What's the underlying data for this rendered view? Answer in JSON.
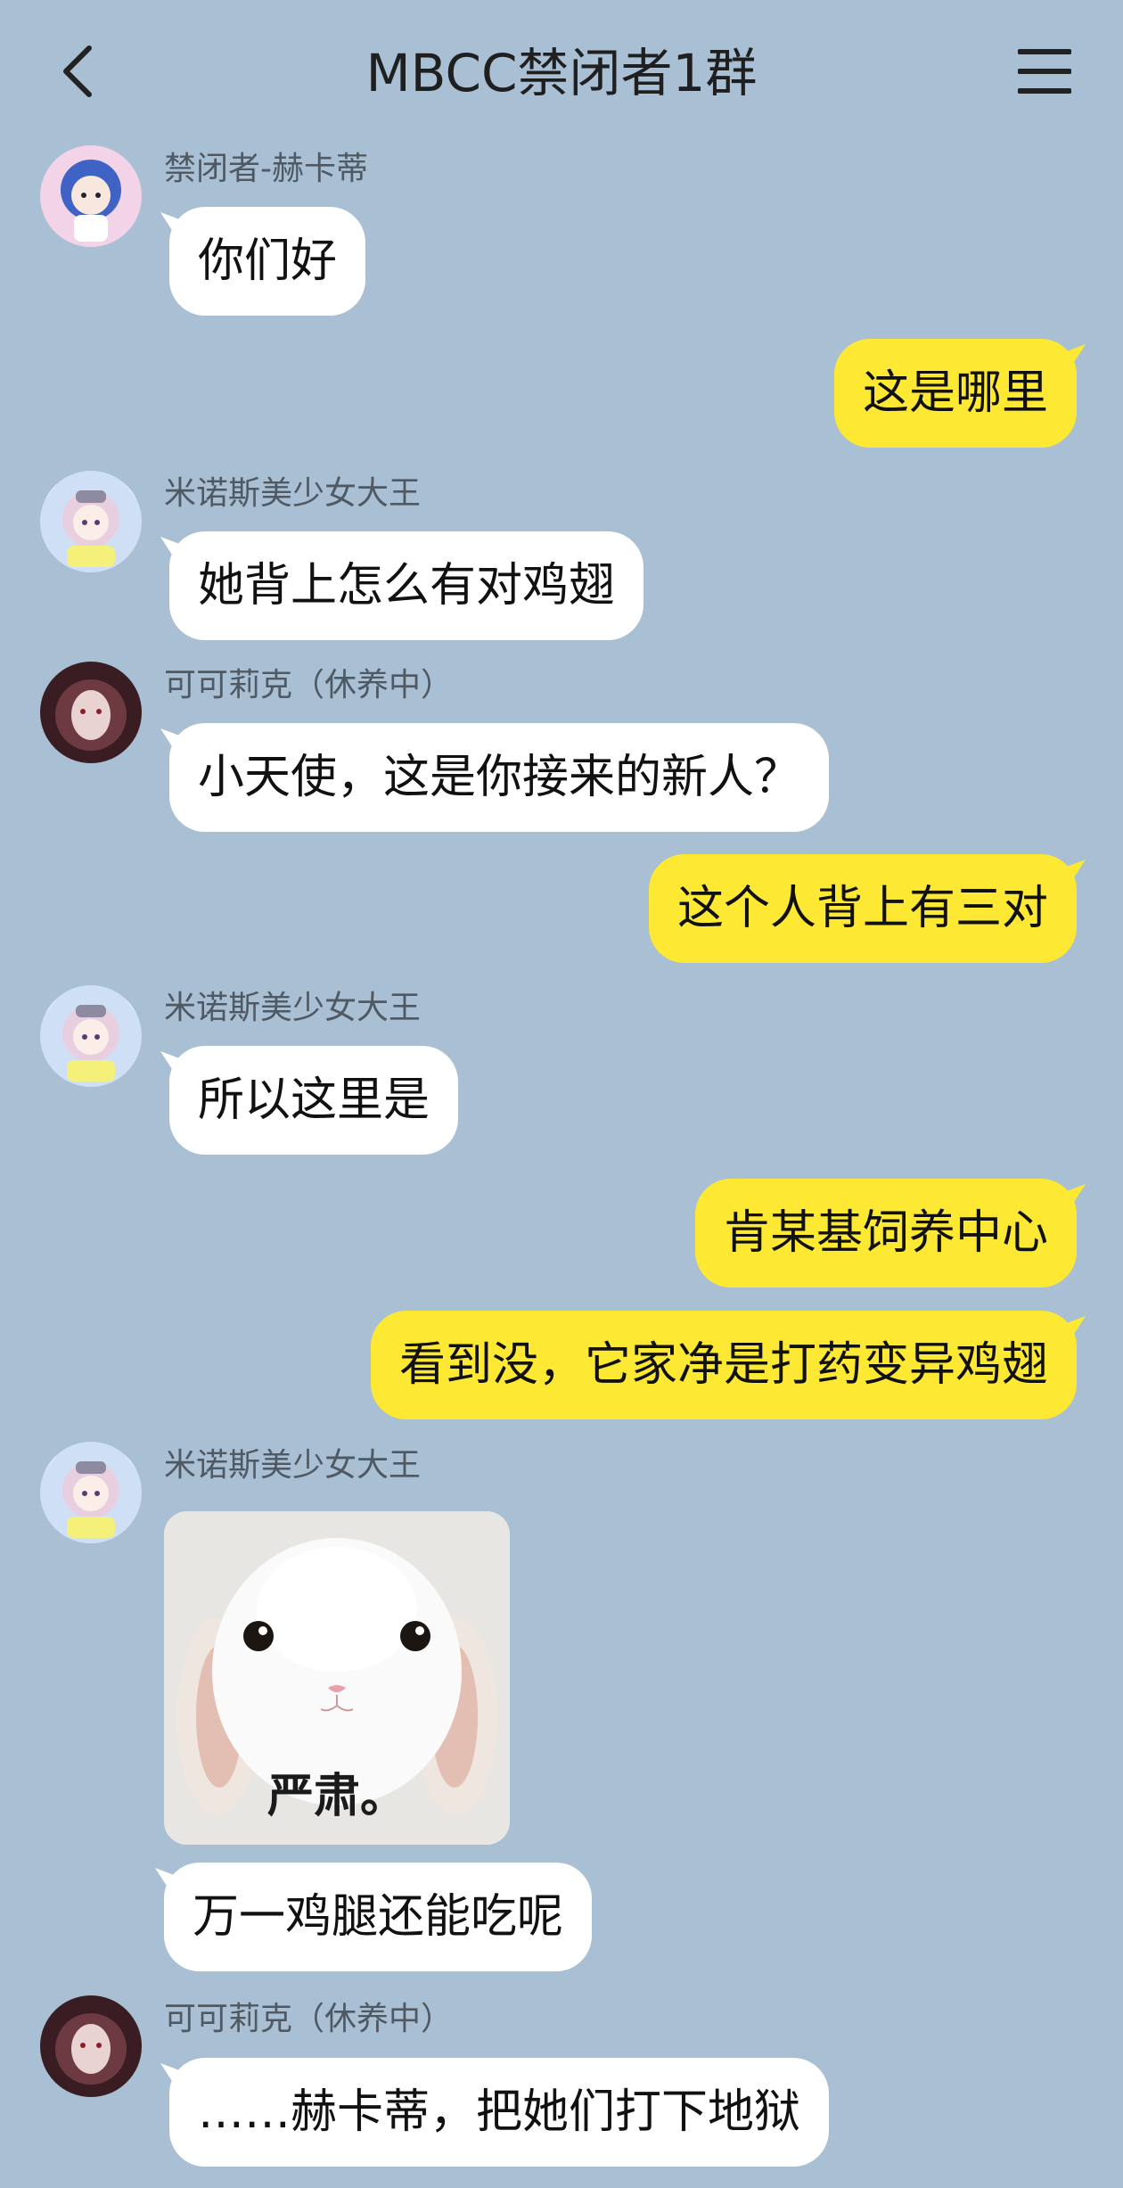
{
  "header": {
    "title": "MBCC禁闭者1群",
    "back_icon": "chevron-left-icon",
    "menu_icon": "hamburger-menu-icon"
  },
  "colors": {
    "background": "#a9bfd3",
    "incoming_bubble": "#ffffff",
    "outgoing_bubble": "#fde933"
  },
  "messages": [
    {
      "sender": "禁闭者-赫卡蒂",
      "text": "你们好",
      "direction": "in"
    },
    {
      "text": "这是哪里",
      "direction": "out"
    },
    {
      "sender": "米诺斯美少女大王",
      "text": "她背上怎么有对鸡翅",
      "direction": "in"
    },
    {
      "sender": "可可莉克（休养中）",
      "text": "小天使，这是你接来的新人？",
      "direction": "in"
    },
    {
      "text": "这个人背上有三对",
      "direction": "out"
    },
    {
      "sender": "米诺斯美少女大王",
      "text": "所以这里是",
      "direction": "in"
    },
    {
      "text": "肯某基饲养中心",
      "direction": "out"
    },
    {
      "text": "看到没，它家净是打药变异鸡翅",
      "direction": "out"
    },
    {
      "sender": "米诺斯美少女大王",
      "sticker_caption": "严肃。",
      "sticker_icon": "white-bunny-sticker",
      "direction": "in"
    },
    {
      "text": "万一鸡腿还能吃呢",
      "direction": "in"
    },
    {
      "sender": "可可莉克（休养中）",
      "text": "……赫卡蒂，把她们打下地狱",
      "direction": "in"
    }
  ]
}
